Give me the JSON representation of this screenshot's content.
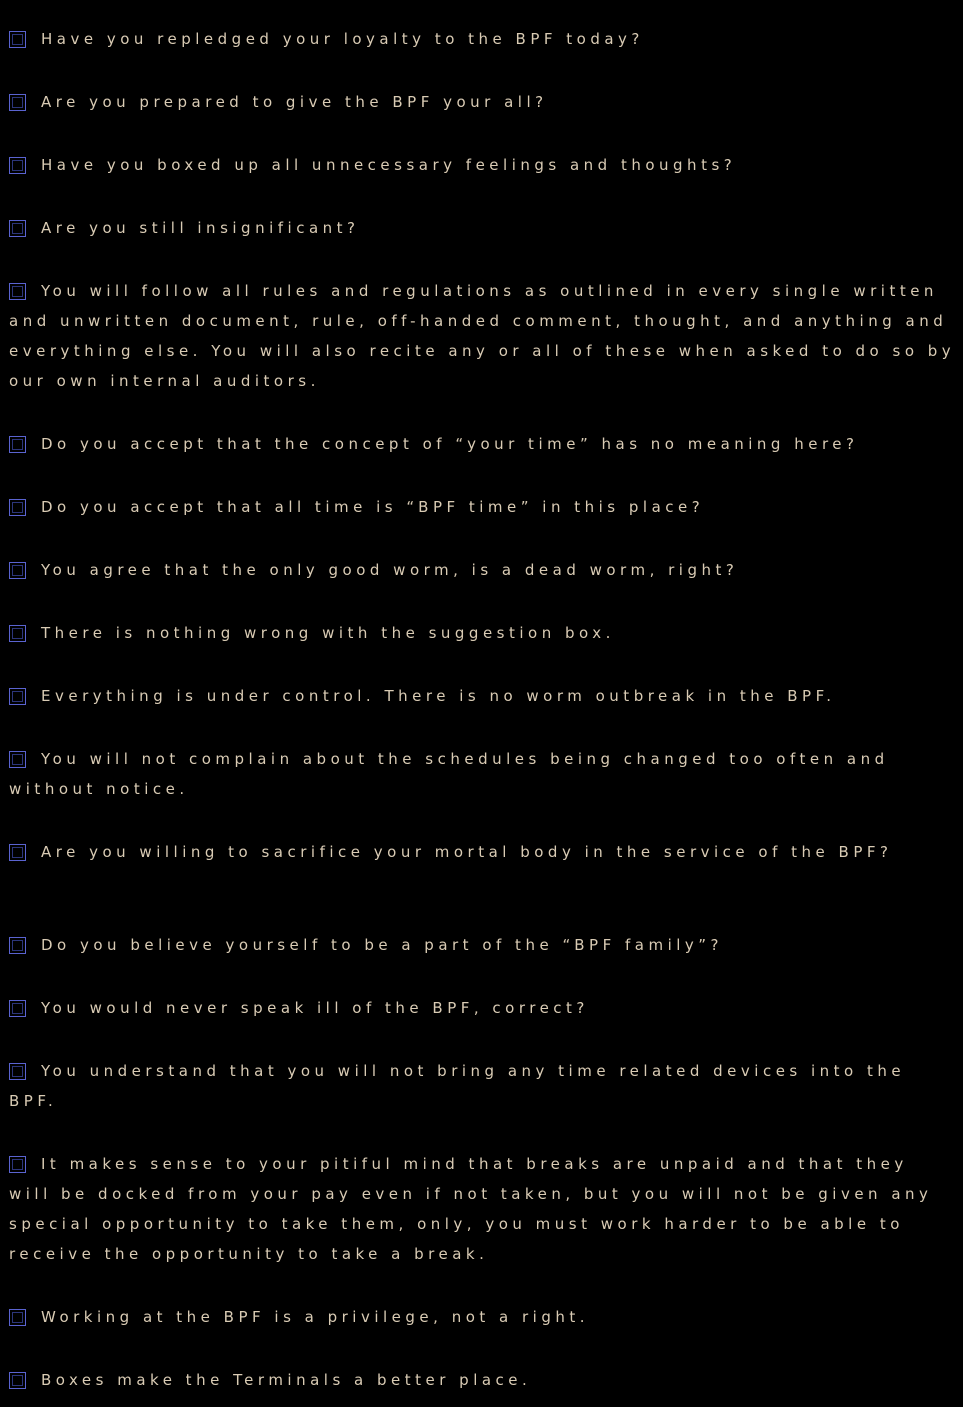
{
  "colors": {
    "background": "#000000",
    "text": "#d9cbb4",
    "checkbox_border": "#5a63d0"
  },
  "checklist": {
    "items": [
      {
        "text": "Have you repledged your loyalty to the BPF today?",
        "checked": false
      },
      {
        "text": "Are you prepared to give the BPF your all?",
        "checked": false
      },
      {
        "text": "Have you boxed up all unnecessary feelings and thoughts?",
        "checked": false
      },
      {
        "text": "Are you still insignificant?",
        "checked": false
      },
      {
        "text": "You will follow all rules and regulations as outlined in every single written and unwritten document, rule, off-handed comment, thought, and anything and everything else. You will also recite any or all of these when asked to do so by our own internal auditors.",
        "checked": false
      },
      {
        "text": "Do you accept that the concept of “your time” has no meaning here?",
        "checked": false
      },
      {
        "text": "Do you accept that all time is “BPF time” in this place?",
        "checked": false
      },
      {
        "text": "You agree that the only good worm, is a dead worm, right?",
        "checked": false
      },
      {
        "text": "There is nothing wrong with the suggestion box.",
        "checked": false
      },
      {
        "text": "Everything is under control. There is no worm outbreak in the BPF.",
        "checked": false
      },
      {
        "text": "You will not complain about the schedules being changed too often and without notice.",
        "checked": false
      },
      {
        "text": "Are you willing to sacrifice your mortal body in the service of the BPF?",
        "checked": false
      },
      {
        "text": "Do you believe yourself to be a part of the “BPF family”?",
        "checked": false
      },
      {
        "text": "You would never speak ill of the BPF, correct?",
        "checked": false
      },
      {
        "text": "You understand that you will not bring any time related devices into the BPF.",
        "checked": false
      },
      {
        "text": "It makes sense to your pitiful mind that breaks are unpaid and that they will be docked from your pay even if not taken, but you will not be given any special opportunity to take them, only, you must work harder to be able to receive the opportunity to take a break.",
        "checked": false
      },
      {
        "text": "Working at the BPF is a privilege, not a right.",
        "checked": false
      },
      {
        "text": "Boxes make the Terminals a better place.",
        "checked": false
      }
    ]
  }
}
